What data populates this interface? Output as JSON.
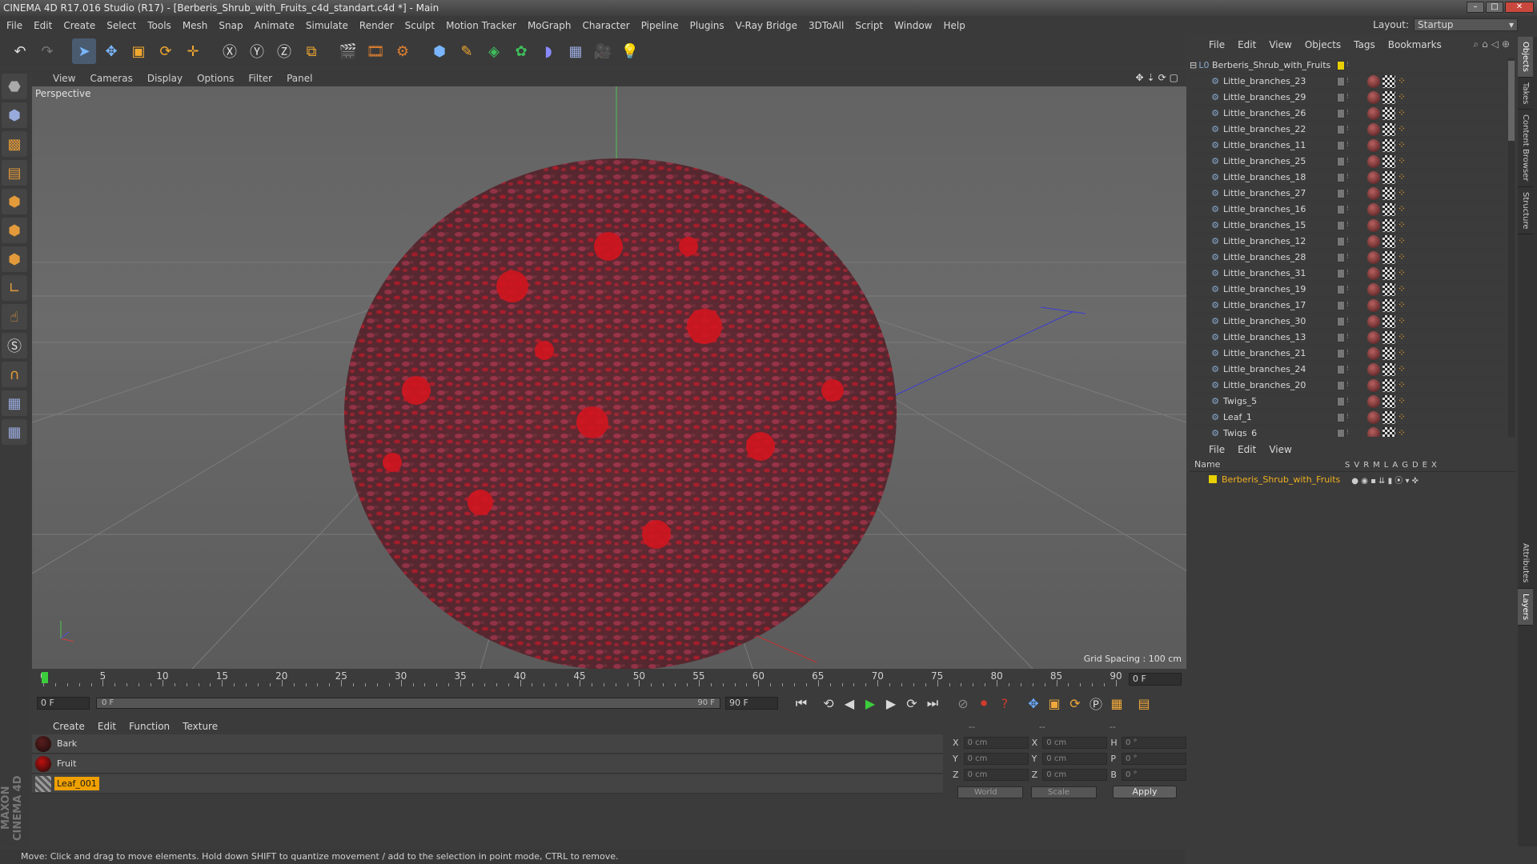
{
  "window": {
    "title": "CINEMA 4D R17.016 Studio (R17) - [Berberis_Shrub_with_Fruits_c4d_standart.c4d *] - Main"
  },
  "menu": [
    "File",
    "Edit",
    "Create",
    "Select",
    "Tools",
    "Mesh",
    "Snap",
    "Animate",
    "Simulate",
    "Render",
    "Sculpt",
    "Motion Tracker",
    "MoGraph",
    "Character",
    "Pipeline",
    "Plugins",
    "V-Ray Bridge",
    "3DToAll",
    "Script",
    "Window",
    "Help"
  ],
  "layout": {
    "label": "Layout:",
    "value": "Startup"
  },
  "viewport": {
    "menu": [
      "View",
      "Cameras",
      "Display",
      "Options",
      "Filter",
      "Panel"
    ],
    "label": "Perspective",
    "grid_spacing": "Grid Spacing : 100 cm"
  },
  "timeline": {
    "ticks": [
      "0",
      "5",
      "10",
      "15",
      "20",
      "25",
      "30",
      "35",
      "40",
      "45",
      "50",
      "55",
      "60",
      "65",
      "70",
      "75",
      "80",
      "85",
      "90"
    ],
    "frame": "0 F",
    "start": "0 F",
    "slider_left": "0 F",
    "slider_right": "90 F",
    "end": "90 F"
  },
  "materials": {
    "menu": [
      "Create",
      "Edit",
      "Function",
      "Texture"
    ],
    "items": [
      {
        "name": "Bark",
        "color": "#5a1e1e"
      },
      {
        "name": "Fruit",
        "color": "#c01010"
      },
      {
        "name": "Leaf_001",
        "color": "#777777"
      }
    ]
  },
  "coords": {
    "headers": [
      "--",
      "--",
      "--"
    ],
    "rows": [
      {
        "a": "X",
        "av": "0 cm",
        "b": "X",
        "bv": "0 cm",
        "c": "H",
        "cv": "0 °"
      },
      {
        "a": "Y",
        "av": "0 cm",
        "b": "Y",
        "bv": "0 cm",
        "c": "P",
        "cv": "0 °"
      },
      {
        "a": "Z",
        "av": "0 cm",
        "b": "Z",
        "bv": "0 cm",
        "c": "B",
        "cv": "0 °"
      }
    ],
    "mode": "World",
    "scale": "Scale",
    "apply": "Apply"
  },
  "status": "Move: Click and drag to move elements. Hold down SHIFT to quantize movement / add to the selection in point mode, CTRL to remove.",
  "brand": "MAXON CINEMA 4D",
  "objects": {
    "menu": [
      "File",
      "Edit",
      "View",
      "Objects",
      "Tags",
      "Bookmarks"
    ],
    "root": "Berberis_Shrub_with_Fruits",
    "items": [
      "Little_branches_23",
      "Little_branches_29",
      "Little_branches_26",
      "Little_branches_22",
      "Little_branches_11",
      "Little_branches_25",
      "Little_branches_18",
      "Little_branches_27",
      "Little_branches_16",
      "Little_branches_15",
      "Little_branches_12",
      "Little_branches_28",
      "Little_branches_31",
      "Little_branches_19",
      "Little_branches_17",
      "Little_branches_30",
      "Little_branches_13",
      "Little_branches_21",
      "Little_branches_24",
      "Little_branches_20",
      "Twigs_5",
      "Leaf_1",
      "Twigs_6"
    ]
  },
  "layers": {
    "menu": [
      "File",
      "Edit",
      "View"
    ],
    "name_header": "Name",
    "cols": [
      "S",
      "V",
      "R",
      "M",
      "L",
      "A",
      "G",
      "D",
      "E",
      "X"
    ],
    "items": [
      "Berberis_Shrub_with_Fruits"
    ]
  },
  "side_tabs": [
    "Objects",
    "Takes",
    "Content Browser",
    "Structure",
    "Attributes",
    "Layers"
  ]
}
